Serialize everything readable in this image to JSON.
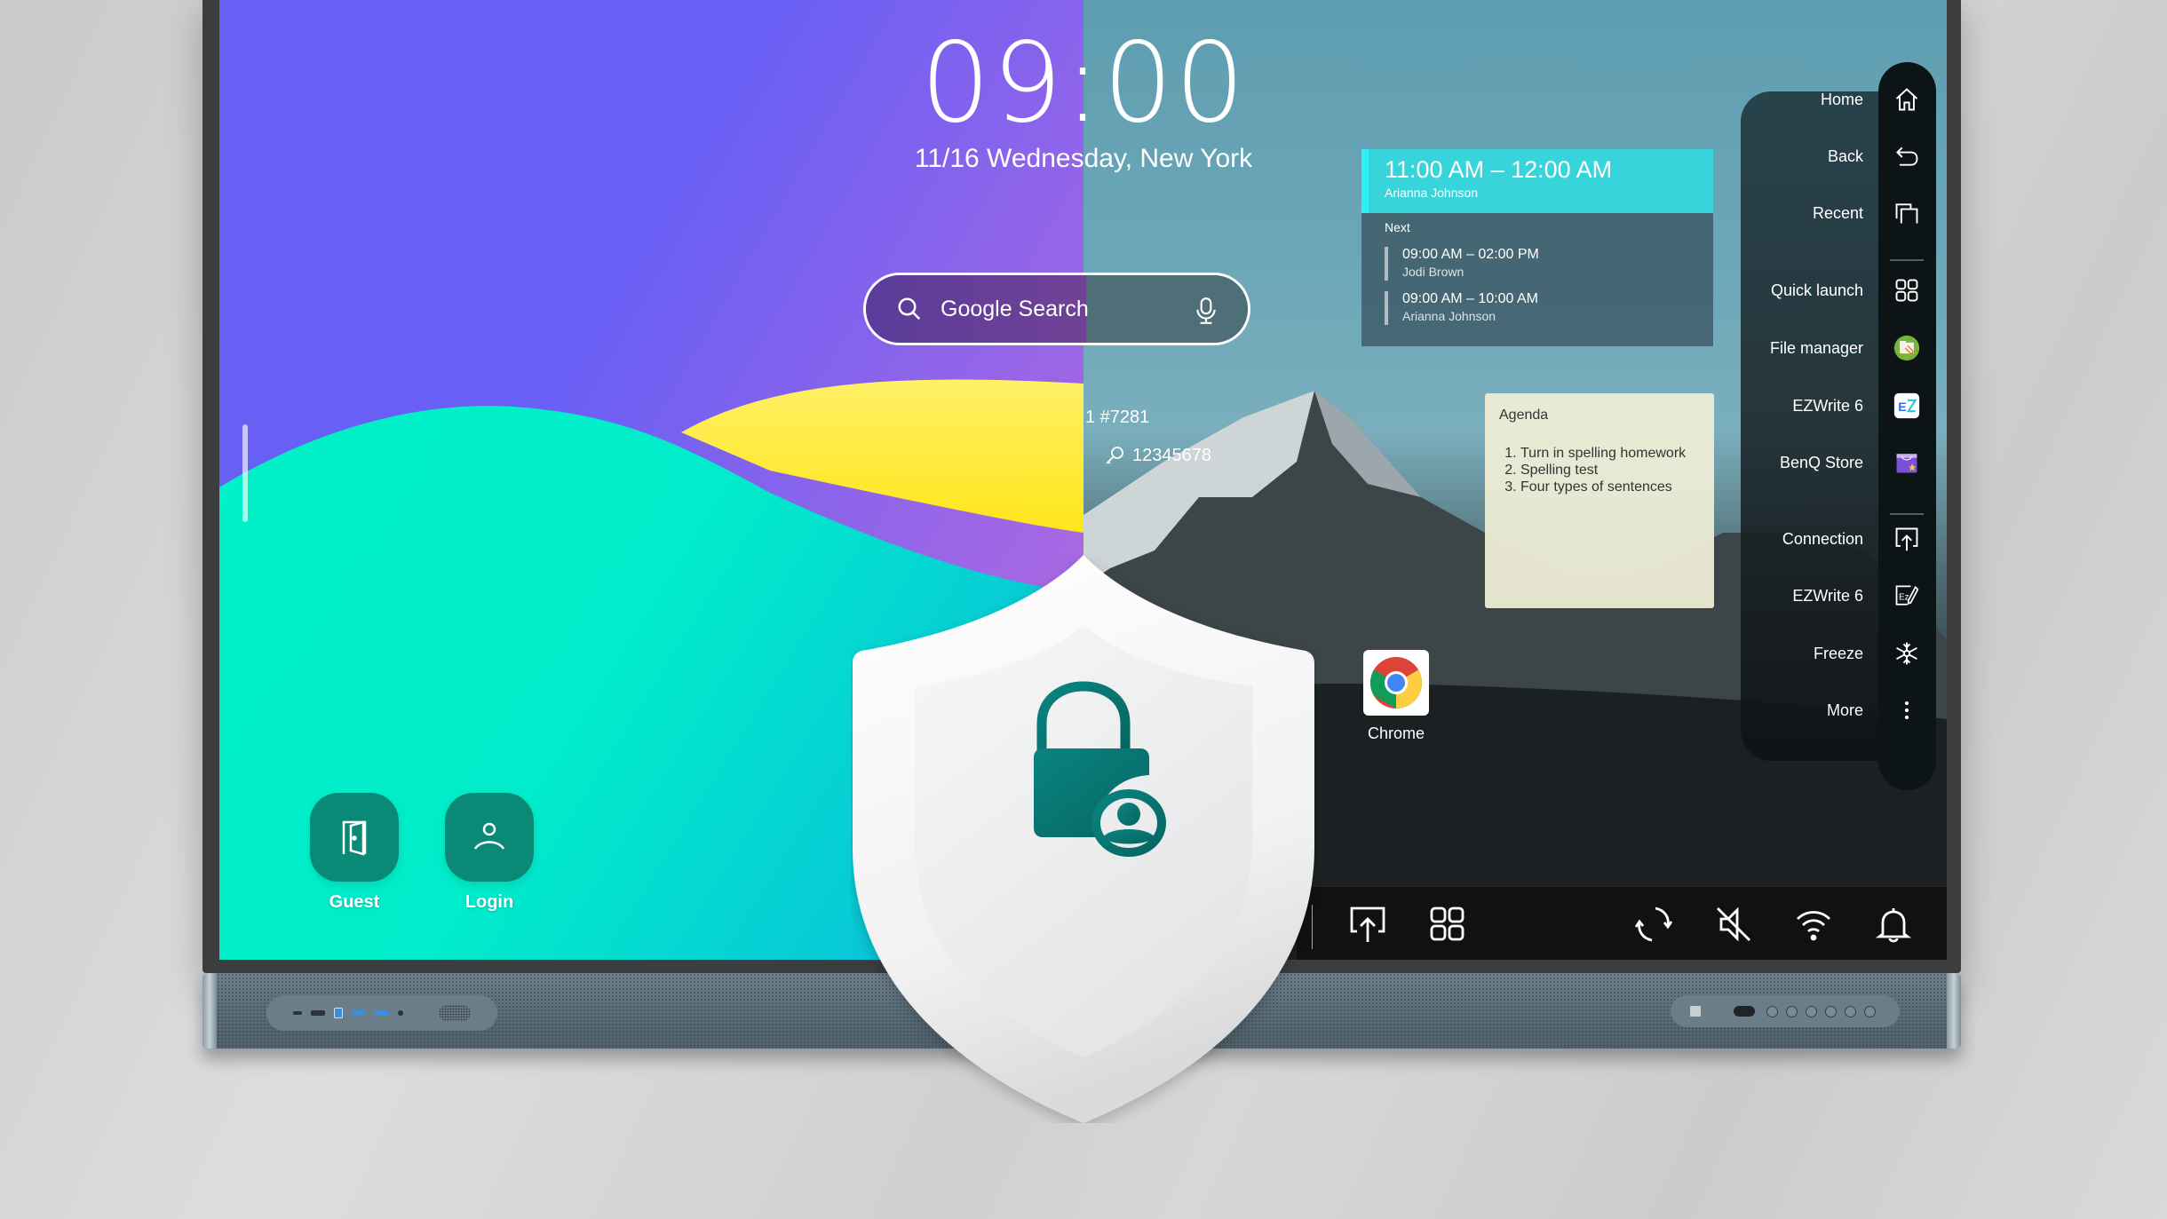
{
  "clock": {
    "time": "09:00",
    "date": "11/16 Wednesday, New York"
  },
  "search": {
    "label": "Google Search",
    "search_icon": "search-icon",
    "mic_icon": "microphone-icon"
  },
  "room": {
    "id": "1 #7281",
    "password": "12345678",
    "password_icon": "key-icon"
  },
  "calendar": {
    "current": {
      "time": "11:00 AM – 12:00 AM",
      "name": "Arianna Johnson"
    },
    "next_heading": "Next",
    "next": [
      {
        "time": "09:00 AM – 02:00 PM",
        "name": "Jodi Brown"
      },
      {
        "time": "09:00 AM – 10:00 AM",
        "name": "Arianna Johnson"
      }
    ]
  },
  "agenda": {
    "title": "Agenda",
    "items": [
      "Turn in spelling homework",
      "Spelling test",
      "Four types of sentences"
    ]
  },
  "apps": {
    "chrome": "Chrome"
  },
  "login": {
    "guest": "Guest",
    "login": "Login"
  },
  "side_menu": {
    "items": [
      {
        "label": "Home",
        "icon": "home-icon"
      },
      {
        "label": "Back",
        "icon": "back-icon"
      },
      {
        "label": "Recent",
        "icon": "recent-icon"
      },
      {
        "label": "Quick launch",
        "icon": "grid-icon"
      },
      {
        "label": "File manager",
        "icon": "file-manager-icon"
      },
      {
        "label": "EZWrite 6",
        "icon": "ezwrite-app-icon"
      },
      {
        "label": "BenQ Store",
        "icon": "store-icon"
      },
      {
        "label": "Connection",
        "icon": "screen-share-icon"
      },
      {
        "label": "EZWrite 6",
        "icon": "ezwrite-pen-icon"
      },
      {
        "label": "Freeze",
        "icon": "snowflake-icon"
      },
      {
        "label": "More",
        "icon": "more-vertical-icon"
      }
    ]
  },
  "taskbar": {
    "icons": [
      "screen-share-icon",
      "grid-icon",
      "rotate-icon",
      "mute-icon",
      "wifi-icon",
      "bell-icon"
    ]
  },
  "colors": {
    "accent_teal": "#0a7a74",
    "calendar_current": "#38d4dc",
    "tile_green": "#0a8a76",
    "wallpaper_purple": "#6660f6",
    "wallpaper_mint": "#00f0c8",
    "wallpaper_yellow": "#ffe930"
  }
}
